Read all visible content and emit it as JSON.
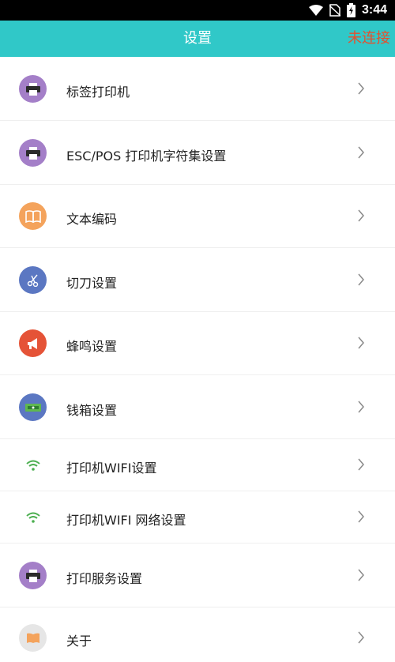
{
  "status_bar": {
    "time": "3:44",
    "icons": [
      "wifi-icon",
      "no-sim-icon",
      "battery-charging-icon"
    ]
  },
  "app_bar": {
    "title": "设置",
    "action_label": "未连接",
    "action_color": "#e4502d",
    "background": "#30c8c8"
  },
  "settings": {
    "items": [
      {
        "label": "标签打印机",
        "icon": "printer-icon",
        "icon_bg": "#a47fc8"
      },
      {
        "label": "ESC/POS 打印机字符集设置",
        "icon": "printer-icon",
        "icon_bg": "#a47fc8"
      },
      {
        "label": "文本编码",
        "icon": "book-icon",
        "icon_bg": "#f4a35c"
      },
      {
        "label": "切刀设置",
        "icon": "scissors-icon",
        "icon_bg": "#5b77c2"
      },
      {
        "label": "蜂鸣设置",
        "icon": "megaphone-icon",
        "icon_bg": "#e55337"
      },
      {
        "label": "钱箱设置",
        "icon": "cash-drawer-icon",
        "icon_bg": "#5b77c2"
      },
      {
        "label": "打印机WIFI设置",
        "icon": "wifi-icon",
        "icon_bg": ""
      },
      {
        "label": "打印机WIFI 网络设置",
        "icon": "wifi-icon",
        "icon_bg": ""
      },
      {
        "label": "打印服务设置",
        "icon": "printer-icon",
        "icon_bg": "#a47fc8"
      },
      {
        "label": "关于",
        "icon": "book-icon",
        "icon_bg": "#e6e6e6"
      }
    ]
  }
}
